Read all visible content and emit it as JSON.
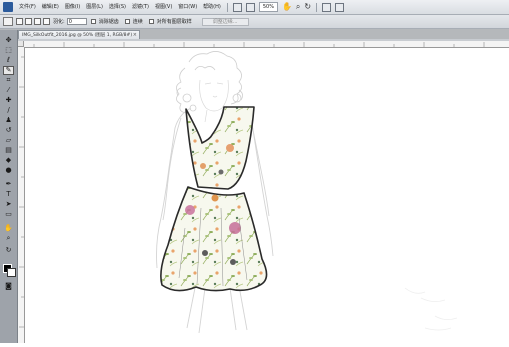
{
  "menubar": {
    "items": [
      "文件(F)",
      "编辑(E)",
      "图像(I)",
      "图层(L)",
      "选择(S)",
      "滤镜(T)",
      "视图(V)",
      "窗口(W)",
      "帮助(H)"
    ],
    "zoom": "50%"
  },
  "options": {
    "feather_label": "羽化:",
    "feather_value": "0",
    "antialias_label": "消除锯齿",
    "contiguous_label": "连续",
    "all_layers_label": "对所有图层取样",
    "refine_edge": "调整边缘..."
  },
  "document": {
    "tab_title": "IMG_SilkOutfit_2016.jpg @ 50% (图层 1, RGB/8#)"
  },
  "toolbox": {
    "tools": [
      "move-tool",
      "marquee-tool",
      "lasso-tool",
      "quick-select-tool",
      "crop-tool",
      "eyedropper-tool",
      "healing-tool",
      "brush-tool",
      "clone-stamp-tool",
      "history-brush-tool",
      "eraser-tool",
      "gradient-tool",
      "blur-tool",
      "dodge-tool",
      "pen-tool",
      "type-tool",
      "path-select-tool",
      "shape-tool",
      "hand-tool",
      "zoom-tool"
    ]
  },
  "colors": {
    "menubar": "#e4e7eb",
    "toolbox": "#9ea3aa",
    "workspace": "#b5b8bb",
    "canvas": "#ffffff"
  }
}
